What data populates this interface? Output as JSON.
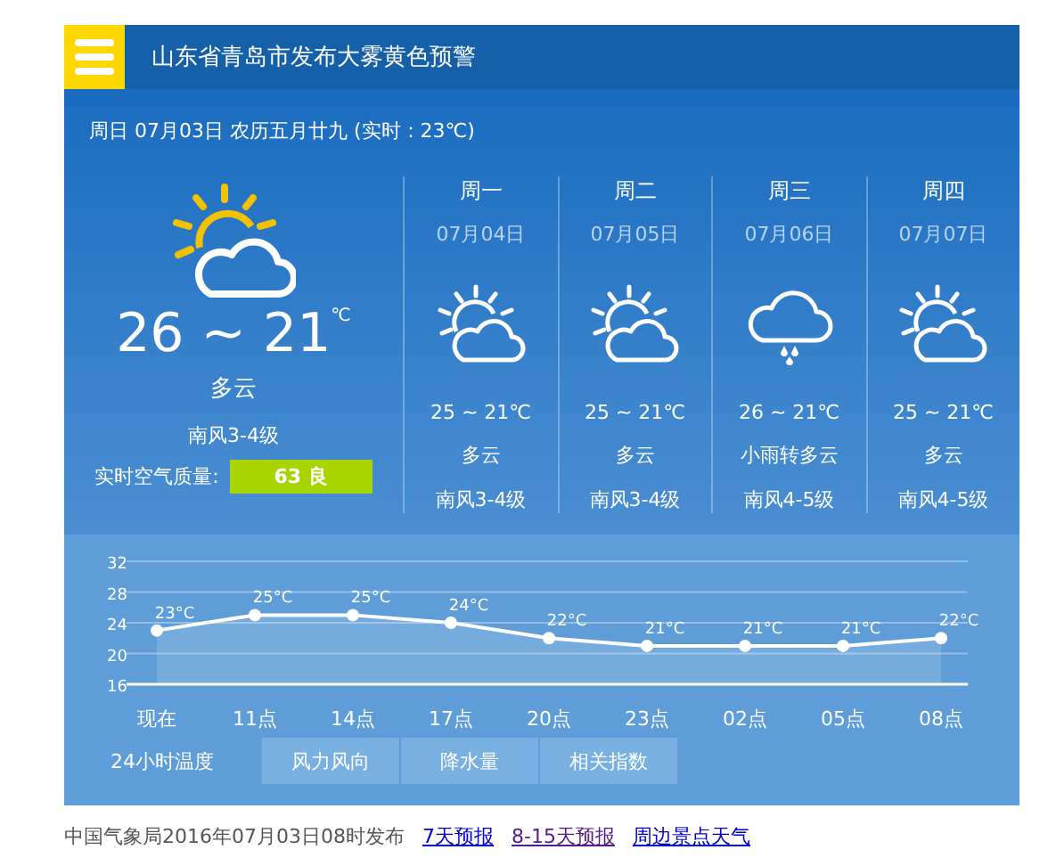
{
  "header": {
    "title": "山东省青岛市发布大雾黄色预警"
  },
  "today": {
    "date_line": "周日 07月03日 农历五月廿九 (实时：23℃)",
    "kind": "partly_cloudy",
    "temp": "26 ~ 21",
    "unit": "℃",
    "condition": "多云",
    "wind": "南风3-4级",
    "aqi_label": "实时空气质量:",
    "aqi_value": "63 良"
  },
  "forecast": [
    {
      "weekday": "周一",
      "date": "07月04日",
      "kind": "partly_cloudy",
      "temp": "25 ~ 21℃",
      "condition": "多云",
      "wind": "南风3-4级"
    },
    {
      "weekday": "周二",
      "date": "07月05日",
      "kind": "partly_cloudy",
      "temp": "25 ~ 21℃",
      "condition": "多云",
      "wind": "南风3-4级"
    },
    {
      "weekday": "周三",
      "date": "07月06日",
      "kind": "rain",
      "temp": "26 ~ 21℃",
      "condition": "小雨转多云",
      "wind": "南风4-5级"
    },
    {
      "weekday": "周四",
      "date": "07月07日",
      "kind": "partly_cloudy",
      "temp": "25 ~ 21℃",
      "condition": "多云",
      "wind": "南风4-5级"
    }
  ],
  "hourly": {
    "chart_data": {
      "type": "area",
      "grid": true,
      "marker": true,
      "categories": [
        "现在",
        "11点",
        "14点",
        "17点",
        "20点",
        "23点",
        "02点",
        "05点",
        "08点"
      ],
      "series": [
        {
          "color": "#ffffff",
          "values": [
            23,
            25,
            25,
            24,
            22,
            21,
            21,
            21,
            22
          ]
        }
      ],
      "ylim": [
        16,
        32
      ],
      "yticks": [
        16,
        20,
        24,
        28,
        32
      ],
      "value_labels": [
        "23°C",
        "25°C",
        "25°C",
        "24°C",
        "22°C",
        "21°C",
        "21°C",
        "21°C",
        "22°C"
      ]
    }
  },
  "tabs": [
    {
      "label": "24小时温度",
      "selected": true
    },
    {
      "label": "风力风向",
      "selected": false
    },
    {
      "label": "降水量",
      "selected": false
    },
    {
      "label": "相关指数",
      "selected": false
    }
  ],
  "footer": {
    "text": "中国气象局2016年07月03日08时发布",
    "links": [
      {
        "label": "7天预报",
        "visited": false
      },
      {
        "label": "8-15天预报",
        "visited": true
      },
      {
        "label": "周边景点天气",
        "visited": false
      }
    ]
  }
}
